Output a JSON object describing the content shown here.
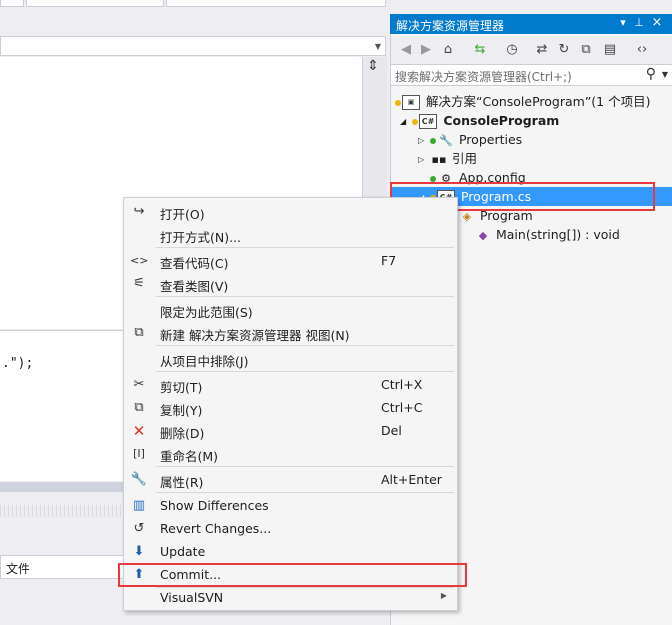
{
  "solution_explorer": {
    "title": "解决方案资源管理器",
    "pin_glyph": "▾",
    "autohide_glyph": "⊥",
    "close_glyph": "×",
    "search_placeholder": "搜索解决方案资源管理器(Ctrl+;)",
    "tree": {
      "solution": "解决方案“ConsoleProgram”(1 个项目)",
      "project": "ConsoleProgram",
      "properties": "Properties",
      "references": "引用",
      "app_config": "App.config",
      "program_cs": "Program.cs",
      "program_class": "Program",
      "main_method": "Main(string[]) : void"
    }
  },
  "editor": {
    "code_fragment": ".\");"
  },
  "bottom_panel": {
    "file_column": "文件"
  },
  "context_menu": {
    "items": [
      {
        "label": "打开(O)",
        "shortcut": "",
        "icon": "open-icon"
      },
      {
        "label": "打开方式(N)...",
        "shortcut": "",
        "icon": ""
      },
      {
        "label": "查看代码(C)",
        "shortcut": "F7",
        "icon": "code-icon"
      },
      {
        "label": "查看类图(V)",
        "shortcut": "",
        "icon": "class-diagram-icon"
      },
      {
        "label": "限定为此范围(S)",
        "shortcut": "",
        "icon": ""
      },
      {
        "label": "新建 解决方案资源管理器 视图(N)",
        "shortcut": "",
        "icon": "new-view-icon"
      },
      {
        "label": "从项目中排除(J)",
        "shortcut": "",
        "icon": ""
      },
      {
        "label": "剪切(T)",
        "shortcut": "Ctrl+X",
        "icon": "cut-icon"
      },
      {
        "label": "复制(Y)",
        "shortcut": "Ctrl+C",
        "icon": "copy-icon"
      },
      {
        "label": "删除(D)",
        "shortcut": "Del",
        "icon": "delete-icon"
      },
      {
        "label": "重命名(M)",
        "shortcut": "",
        "icon": "rename-icon"
      },
      {
        "label": "属性(R)",
        "shortcut": "Alt+Enter",
        "icon": "wrench-icon"
      },
      {
        "label": "Show Differences",
        "shortcut": "",
        "icon": "diff-icon"
      },
      {
        "label": "Revert Changes...",
        "shortcut": "",
        "icon": "revert-icon"
      },
      {
        "label": "Update",
        "shortcut": "",
        "icon": "update-icon"
      },
      {
        "label": "Commit...",
        "shortcut": "",
        "icon": "commit-icon"
      },
      {
        "label": "VisualSVN",
        "shortcut": "",
        "icon": ""
      }
    ]
  },
  "colors": {
    "accent": "#007acc",
    "selection": "#3399ff",
    "highlight_box": "#e8393f"
  }
}
